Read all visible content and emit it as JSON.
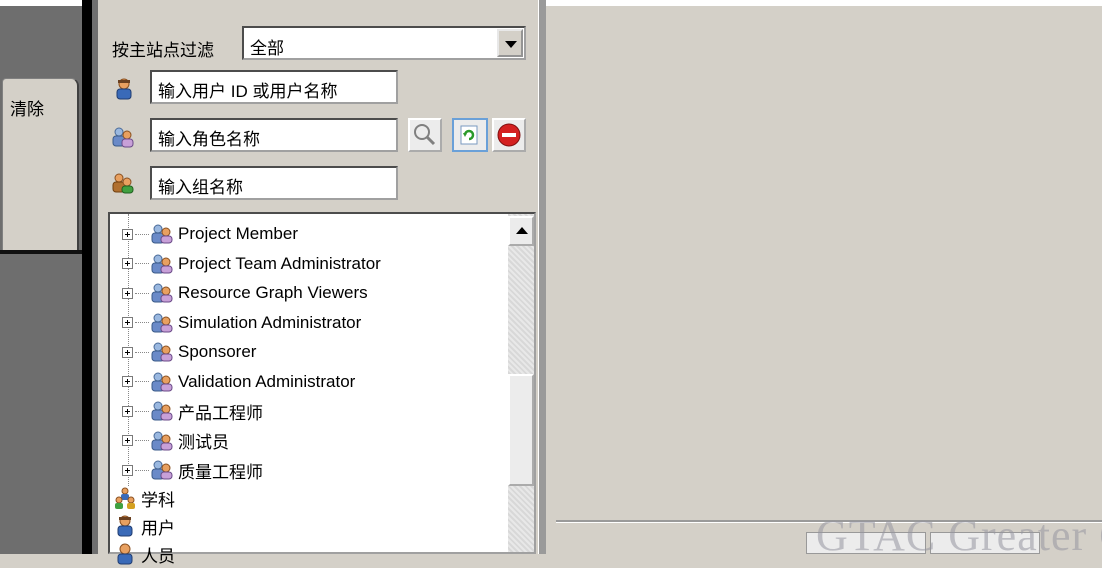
{
  "left_tab": {
    "label": "清除"
  },
  "filter": {
    "label": "按主站点过滤",
    "site_value": "全部"
  },
  "fields": {
    "user_placeholder": "输入用户 ID 或用户名称",
    "role_placeholder": "输入角色名称",
    "group_placeholder": "输入组名称"
  },
  "tree": {
    "roles": [
      "Project Member",
      "Project Team Administrator",
      "Resource Graph Viewers",
      "Simulation Administrator",
      "Sponsorer",
      "Validation Administrator",
      "产品工程师",
      "测试员",
      "质量工程师"
    ],
    "nodes": [
      {
        "label": "学科",
        "icon": "discipline-icon"
      },
      {
        "label": "用户",
        "icon": "user-icon"
      },
      {
        "label": "人员",
        "icon": "person-icon"
      }
    ]
  },
  "colors": {
    "panel_bg": "#d4d0c8",
    "dark_strip": "#6e6e6e",
    "stop_red": "#d42020"
  },
  "watermark": "GTAC Greater C"
}
